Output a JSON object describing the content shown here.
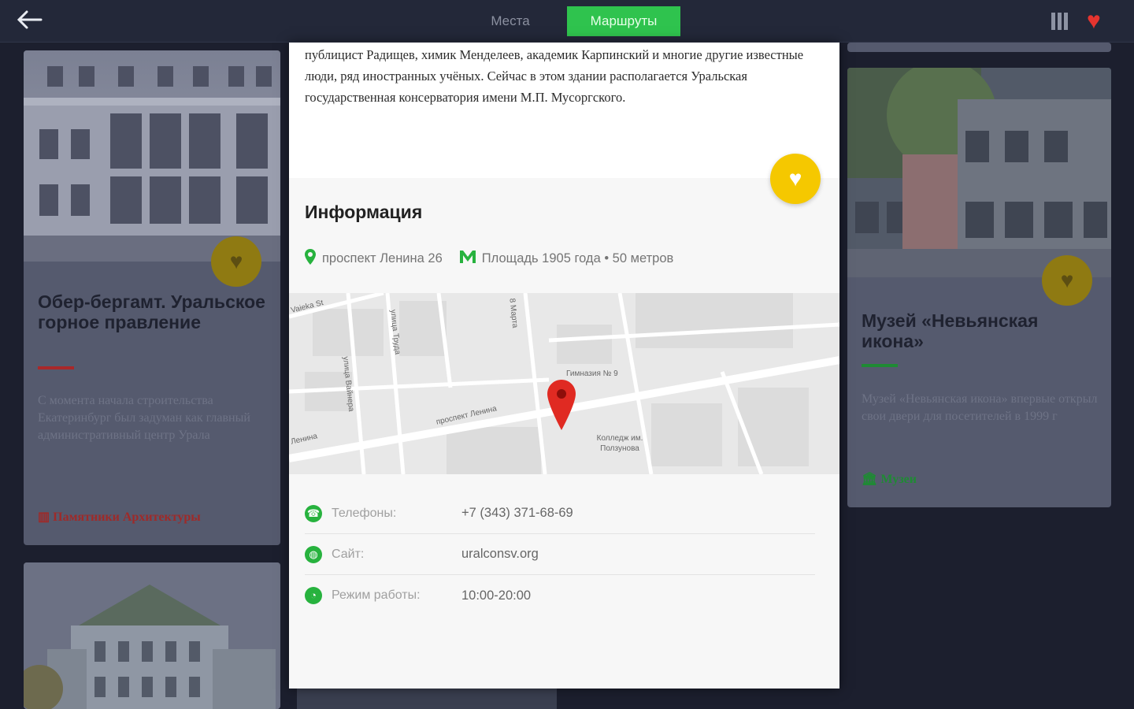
{
  "topbar": {
    "back_icon": "arrow-left-icon",
    "tabs": [
      {
        "label": "Места"
      },
      {
        "label": "Маршруты"
      }
    ],
    "active_tab": "Маршруты",
    "accent": "#2fc34e"
  },
  "left_card": {
    "title": "Обер-бергамт. Уральское горное правление",
    "description": "С момента начала строительства Екатеринбург был задуман как главный административный центр Урала",
    "category": "Памятники Архитектуры",
    "category_color": "#d0312d"
  },
  "right_card": {
    "title": "Музей «Невьянская икона»",
    "description": "Музей «Невьянская икона» впервые открыл свои двери для посетителей в 1999 г",
    "category": "Музеи",
    "category_color": "#2fc34e"
  },
  "detail": {
    "text": "публицист Радищев, химик Менделеев, академик Карпинский и многие другие известные люди, ряд иностранных учёных. Сейчас в этом здании располагается Уральская государственная консерватория имени М.П. Мусоргского.",
    "info_heading": "Информация",
    "address": "проспект Ленина 26",
    "metro": "Площадь 1905 года • 50 метров",
    "map_labels": [
      "Vaieka St",
      "улица Труда",
      "улица Вайнера",
      "проспект Ленина",
      "8 Марта",
      "Гимназия № 9",
      "Колледж им. Ползунова",
      "Ленина"
    ],
    "phone_label": "Телефоны:",
    "phone_value": "+7 (343) 371-68-69",
    "site_label": "Сайт:",
    "site_value": "uralconsv.org",
    "hours_label": "Режим работы:",
    "hours_value": "10:00-20:00",
    "fav_color": "#f5c800"
  }
}
